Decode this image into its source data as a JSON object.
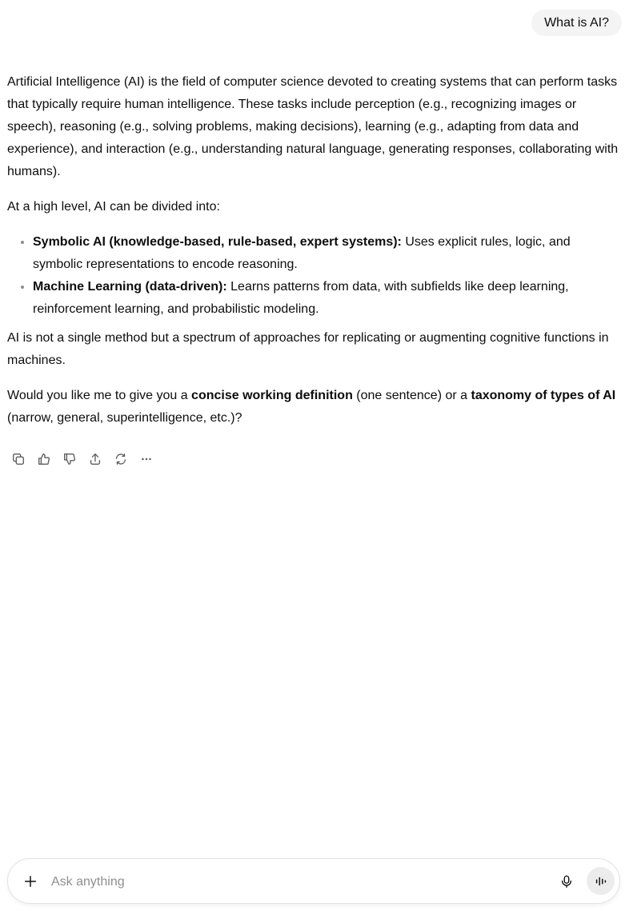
{
  "user_message": "What is AI?",
  "answer": {
    "para1": "Artificial Intelligence (AI) is the field of computer science devoted to creating systems that can perform tasks that typically require human intelligence. These tasks include perception (e.g., recognizing images or speech), reasoning (e.g., solving problems, making decisions), learning (e.g., adapting from data and experience), and interaction (e.g., understanding natural language, generating responses, collaborating with humans).",
    "para2": "At a high level, AI can be divided into:",
    "bullets": [
      {
        "bold": "Symbolic AI (knowledge-based, rule-based, expert systems):",
        "text": " Uses explicit rules, logic, and symbolic representations to encode reasoning."
      },
      {
        "bold": "Machine Learning (data-driven):",
        "text": " Learns patterns from data, with subfields like deep learning, reinforcement learning, and probabilistic modeling."
      }
    ],
    "para3": "AI is not a single method but a spectrum of approaches for replicating or augmenting cognitive functions in machines.",
    "para4": {
      "t1": "Would you like me to give you a ",
      "b1": "concise working definition",
      "t2": " (one sentence) or a ",
      "b2": "taxonomy of types of AI",
      "t3": " (narrow, general, superintelligence, etc.)?"
    }
  },
  "actions": [
    "copy-icon",
    "thumbs-up-icon",
    "thumbs-down-icon",
    "share-icon",
    "regenerate-icon",
    "more-icon"
  ],
  "composer": {
    "placeholder": "Ask anything",
    "value": ""
  }
}
